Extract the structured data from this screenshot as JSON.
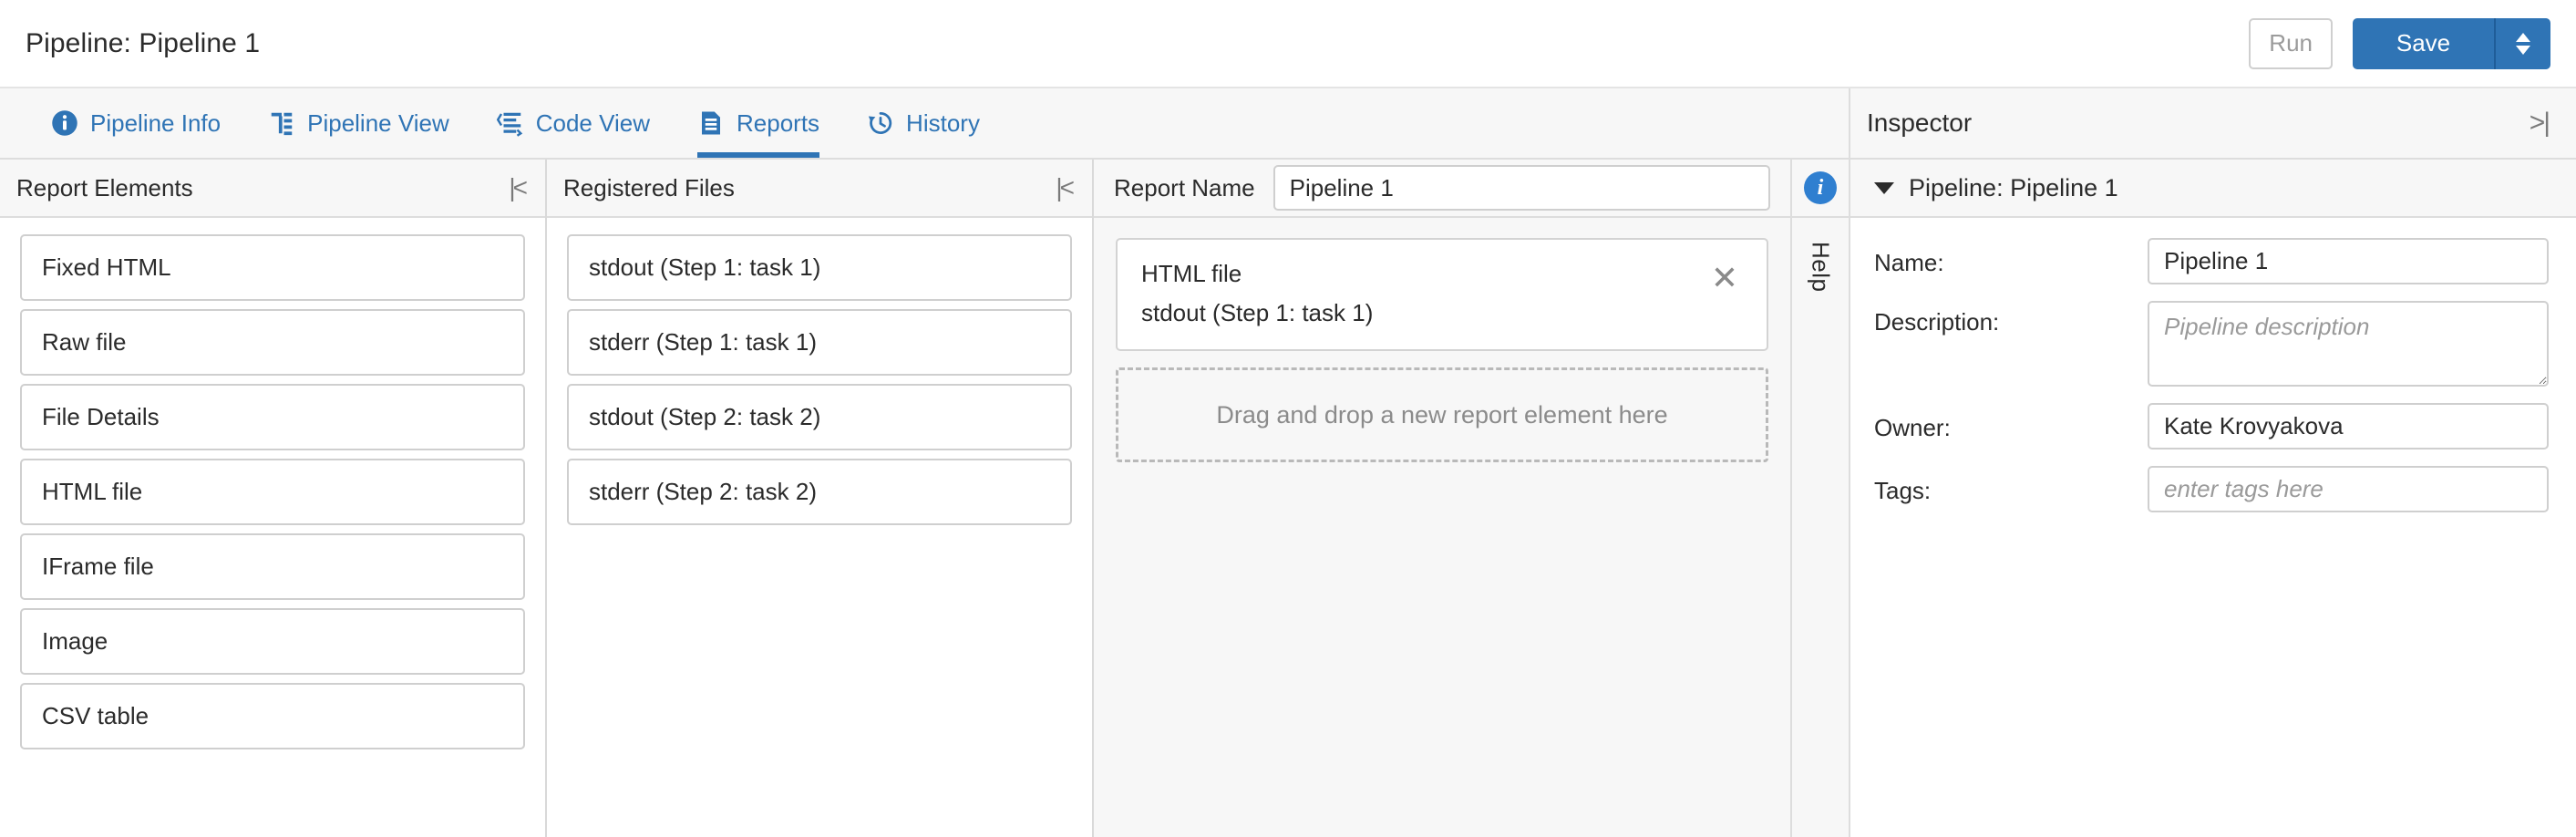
{
  "header": {
    "title": "Pipeline: Pipeline 1",
    "run_label": "Run",
    "save_label": "Save",
    "save_caret_icon": "chevron-up-down-icon"
  },
  "tabs": [
    {
      "label": "Pipeline Info",
      "icon": "info-circle-icon",
      "active": false
    },
    {
      "label": "Pipeline View",
      "icon": "tree-view-icon",
      "active": false
    },
    {
      "label": "Code View",
      "icon": "code-lines-icon",
      "active": false
    },
    {
      "label": "Reports",
      "icon": "document-icon",
      "active": true
    },
    {
      "label": "History",
      "icon": "clock-back-icon",
      "active": false
    }
  ],
  "inspector_header": {
    "title": "Inspector",
    "collapse_icon": ">|"
  },
  "report_elements": {
    "title": "Report Elements",
    "collapse_icon": "|<",
    "items": [
      "Fixed HTML",
      "Raw file",
      "File Details",
      "HTML file",
      "IFrame file",
      "Image",
      "CSV table"
    ]
  },
  "registered_files": {
    "title": "Registered Files",
    "collapse_icon": "|<",
    "items": [
      "stdout (Step 1: task 1)",
      "stderr (Step 1: task 1)",
      "stdout (Step 2: task 2)",
      "stderr (Step 2: task 2)"
    ]
  },
  "report": {
    "name_label": "Report Name",
    "name_value": "Pipeline 1",
    "cards": [
      {
        "title": "HTML file",
        "subtitle": "stdout (Step 1: task 1)",
        "close_icon": "close-icon"
      }
    ],
    "dropzone_text": "Drag and drop a new report element here"
  },
  "help_rail": {
    "info_icon": "info-circle-icon",
    "label": "Help"
  },
  "inspector": {
    "section_title": "Pipeline: Pipeline 1",
    "fields": {
      "name_label": "Name:",
      "name_value": "Pipeline 1",
      "description_label": "Description:",
      "description_value": "",
      "description_placeholder": "Pipeline description",
      "owner_label": "Owner:",
      "owner_value": "Kate Krovyakova",
      "tags_label": "Tags:",
      "tags_value": "",
      "tags_placeholder": "enter tags here"
    }
  },
  "colors": {
    "accent": "#2f74b5",
    "info": "#2f7fd0",
    "panel_bg": "#f7f7f7",
    "border": "#d9d9d9"
  }
}
